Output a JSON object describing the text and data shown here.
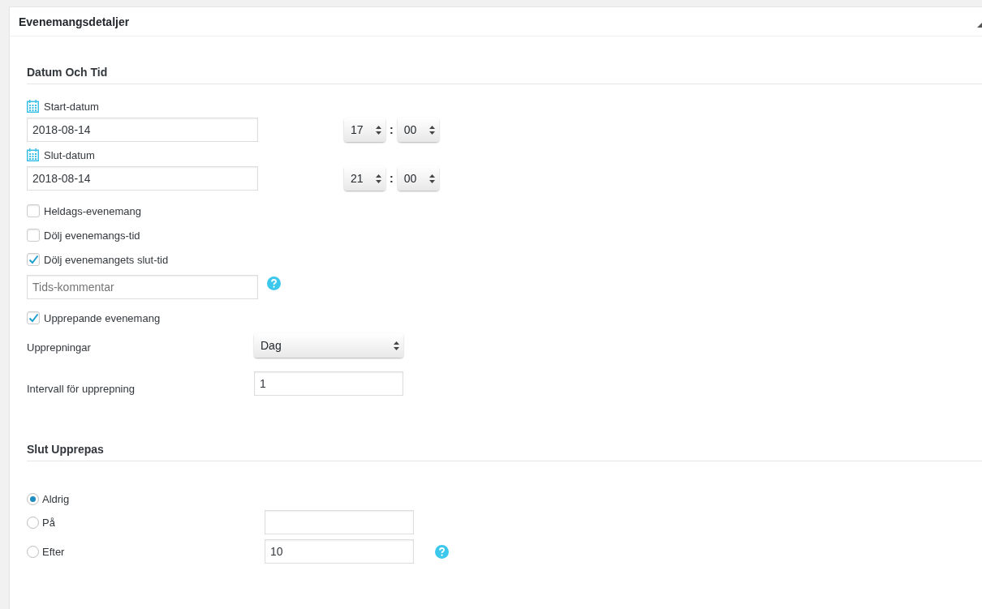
{
  "panel": {
    "title": "Evenemangsdetaljer",
    "expanded": true
  },
  "date_time": {
    "heading": "Datum Och Tid",
    "dates": [
      {
        "label": "Start-datum",
        "value": "2018-08-14",
        "hour": "17",
        "separator": ":",
        "minute": "00"
      },
      {
        "label": "Slut-datum",
        "value": "2018-08-14",
        "hour": "21",
        "separator": ":",
        "minute": "00"
      }
    ],
    "options": [
      {
        "label": "Heldags-evenemang",
        "checked": false
      },
      {
        "label": "Dölj evenemangs-tid",
        "checked": false
      },
      {
        "label": "Dölj evenemangets slut-tid",
        "checked": true
      }
    ],
    "comment": {
      "placeholder": "Tids-kommentar"
    },
    "recurring": {
      "label": "Upprepande evenemang",
      "checked": true
    },
    "repeat": {
      "label": "Upprepningar",
      "value": "Dag"
    },
    "interval": {
      "label": "Intervall för upprepning",
      "value": "1"
    }
  },
  "end_repeat": {
    "heading": "Slut Upprepas",
    "options": [
      {
        "label": "Aldrig",
        "selected": true,
        "kind": "plain"
      },
      {
        "label": "På",
        "selected": false,
        "kind": "date"
      },
      {
        "label": "Efter",
        "selected": false,
        "kind": "count",
        "value": "10"
      }
    ]
  }
}
